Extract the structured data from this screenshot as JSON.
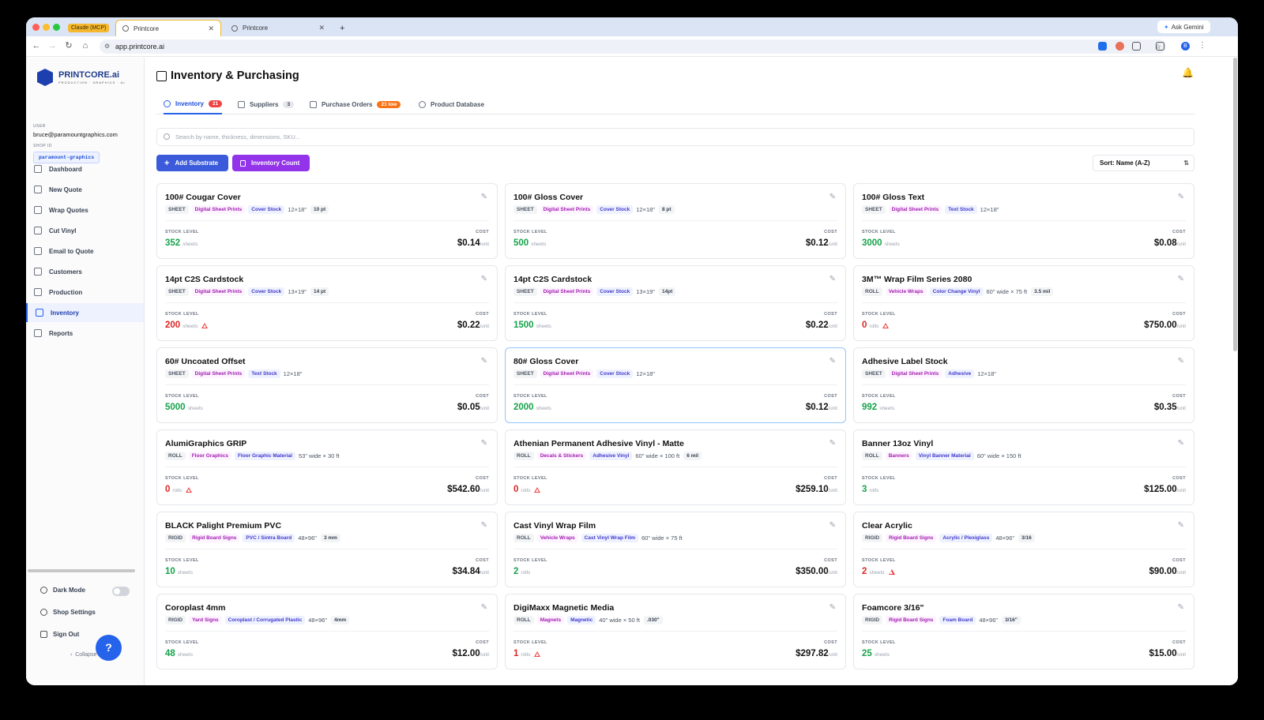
{
  "browser": {
    "tabs": [
      {
        "label": "Claude (MCP)"
      },
      {
        "label": "Printcore"
      },
      {
        "label": "Printcore"
      }
    ],
    "url": "app.printcore.ai",
    "ask_label": "Ask Gemini",
    "profile_initial": "B"
  },
  "sidebar": {
    "logo_title": "PRINTCORE.ai",
    "logo_sub": "PRODUCTION · GRAPHICS · AI",
    "user_label": "USER",
    "user_email": "bruce@paramountgraphics.com",
    "shop_label": "SHOP ID",
    "shop_id": "paramount-graphics",
    "nav": [
      {
        "label": "Dashboard",
        "icon": "grid-icon"
      },
      {
        "label": "New Quote",
        "icon": "document-icon"
      },
      {
        "label": "Wrap Quotes",
        "icon": "car-icon"
      },
      {
        "label": "Cut Vinyl",
        "icon": "scissors-icon"
      },
      {
        "label": "Email to Quote",
        "icon": "mail-icon"
      },
      {
        "label": "Customers",
        "icon": "users-icon"
      },
      {
        "label": "Production",
        "icon": "factory-icon"
      },
      {
        "label": "Inventory",
        "icon": "package-icon",
        "active": true
      },
      {
        "label": "Reports",
        "icon": "chart-icon"
      }
    ],
    "dark_mode": "Dark Mode",
    "shop_settings": "Shop Settings",
    "sign_out": "Sign Out",
    "collapse": "Collapse",
    "help_glyph": "?"
  },
  "header": {
    "title": "Inventory & Purchasing"
  },
  "tabs": [
    {
      "label": "Inventory",
      "badge": "21"
    },
    {
      "label": "Suppliers",
      "badge": "3"
    },
    {
      "label": "Purchase Orders",
      "badge": "21 low"
    },
    {
      "label": "Product Database",
      "badge": ""
    }
  ],
  "search": {
    "placeholder": "Search by name, thickness, dimensions, SKU..."
  },
  "actions": {
    "add_substrate": "Add Substrate",
    "inventory_count": "Inventory Count",
    "sort": "Sort: Name (A-Z)"
  },
  "labels": {
    "stock_level": "STOCK LEVEL",
    "cost": "COST",
    "per_unit": "/unit"
  },
  "colors": {
    "accent": "#2563eb",
    "purple": "#9333ea",
    "in_stock": "#16a34a",
    "out_of_stock": "#dc2626",
    "low_badge": "#f97316"
  },
  "items": [
    {
      "name": "100# Cougar Cover",
      "type": "SHEET",
      "category": "Digital Sheet Prints",
      "material": "Cover Stock",
      "dims": "12×18\"",
      "thickness": "10 pt",
      "qty": "352",
      "unit": "sheets",
      "cost": "$0.14",
      "low": false
    },
    {
      "name": "100# Gloss Cover",
      "type": "SHEET",
      "category": "Digital Sheet Prints",
      "material": "Cover Stock",
      "dims": "12×18\"",
      "thickness": "8 pt",
      "qty": "500",
      "unit": "sheets",
      "cost": "$0.12",
      "low": false
    },
    {
      "name": "100# Gloss Text",
      "type": "SHEET",
      "category": "Digital Sheet Prints",
      "material": "Text Stock",
      "dims": "12×18\"",
      "thickness": "",
      "qty": "3000",
      "unit": "sheets",
      "cost": "$0.08",
      "low": false
    },
    {
      "name": "14pt C2S Cardstock",
      "type": "SHEET",
      "category": "Digital Sheet Prints",
      "material": "Cover Stock",
      "dims": "13×19\"",
      "thickness": "14 pt",
      "qty": "200",
      "unit": "sheets",
      "cost": "$0.22",
      "low": true
    },
    {
      "name": "14pt C2S Cardstock",
      "type": "SHEET",
      "category": "Digital Sheet Prints",
      "material": "Cover Stock",
      "dims": "13×19\"",
      "thickness": "14pt",
      "qty": "1500",
      "unit": "sheets",
      "cost": "$0.22",
      "low": false
    },
    {
      "name": "3M™ Wrap Film Series 2080",
      "type": "ROLL",
      "category": "Vehicle Wraps",
      "material": "Color Change Vinyl",
      "dims": "60\" wide × 75 ft",
      "thickness": "3.5 mil",
      "qty": "0",
      "unit": "rolls",
      "cost": "$750.00",
      "low": true
    },
    {
      "name": "60# Uncoated Offset",
      "type": "SHEET",
      "category": "Digital Sheet Prints",
      "material": "Text Stock",
      "dims": "12×18\"",
      "thickness": "",
      "qty": "5000",
      "unit": "sheets",
      "cost": "$0.05",
      "low": false
    },
    {
      "name": "80# Gloss Cover",
      "type": "SHEET",
      "category": "Digital Sheet Prints",
      "material": "Cover Stock",
      "dims": "12×18\"",
      "thickness": "",
      "qty": "2000",
      "unit": "sheets",
      "cost": "$0.12",
      "low": false
    },
    {
      "name": "Adhesive Label Stock",
      "type": "SHEET",
      "category": "Digital Sheet Prints",
      "material": "Adhesive",
      "dims": "12×18\"",
      "thickness": "",
      "qty": "992",
      "unit": "sheets",
      "cost": "$0.35",
      "low": false
    },
    {
      "name": "AlumiGraphics GRIP",
      "type": "ROLL",
      "category": "Floor Graphics",
      "material": "Floor Graphic Material",
      "dims": "53\" wide × 30 ft",
      "thickness": "",
      "qty": "0",
      "unit": "rolls",
      "cost": "$542.60",
      "low": true
    },
    {
      "name": "Athenian Permanent Adhesive Vinyl - Matte",
      "type": "ROLL",
      "category": "Decals & Stickers",
      "material": "Adhesive Vinyl",
      "dims": "60\" wide × 100 ft",
      "thickness": "6 mil",
      "qty": "0",
      "unit": "rolls",
      "cost": "$259.10",
      "low": true
    },
    {
      "name": "Banner 13oz Vinyl",
      "type": "ROLL",
      "category": "Banners",
      "material": "Vinyl Banner Material",
      "dims": "60\" wide × 150 ft",
      "thickness": "",
      "qty": "3",
      "unit": "rolls",
      "cost": "$125.00",
      "low": false
    },
    {
      "name": "BLACK Palight Premium PVC",
      "type": "RIGID",
      "category": "Rigid Board Signs",
      "material": "PVC / Sintra Board",
      "dims": "48×96\"",
      "thickness": "3 mm",
      "qty": "10",
      "unit": "sheets",
      "cost": "$34.84",
      "low": false
    },
    {
      "name": "Cast Vinyl Wrap Film",
      "type": "ROLL",
      "category": "Vehicle Wraps",
      "material": "Cast Vinyl Wrap Film",
      "dims": "60\" wide × 75 ft",
      "thickness": "",
      "qty": "2",
      "unit": "rolls",
      "cost": "$350.00",
      "low": false
    },
    {
      "name": "Clear Acrylic",
      "type": "RIGID",
      "category": "Rigid Board Signs",
      "material": "Acrylic / Plexiglass",
      "dims": "48×96\"",
      "thickness": "3/16",
      "qty": "2",
      "unit": "sheets",
      "cost": "$90.00",
      "low": true
    },
    {
      "name": "Coroplast 4mm",
      "type": "RIGID",
      "category": "Yard Signs",
      "material": "Coroplast / Corrugated Plastic",
      "dims": "48×96\"",
      "thickness": "4mm",
      "qty": "48",
      "unit": "sheets",
      "cost": "$12.00",
      "low": false
    },
    {
      "name": "DigiMaxx Magnetic Media",
      "type": "ROLL",
      "category": "Magnets",
      "material": "Magnetic",
      "dims": "40\" wide × 50 ft",
      "thickness": ".030\"",
      "qty": "1",
      "unit": "rolls",
      "cost": "$297.82",
      "low": true
    },
    {
      "name": "Foamcore 3/16\"",
      "type": "RIGID",
      "category": "Rigid Board Signs",
      "material": "Foam Board",
      "dims": "48×96\"",
      "thickness": "3/16\"",
      "qty": "25",
      "unit": "sheets",
      "cost": "$15.00",
      "low": false
    }
  ]
}
